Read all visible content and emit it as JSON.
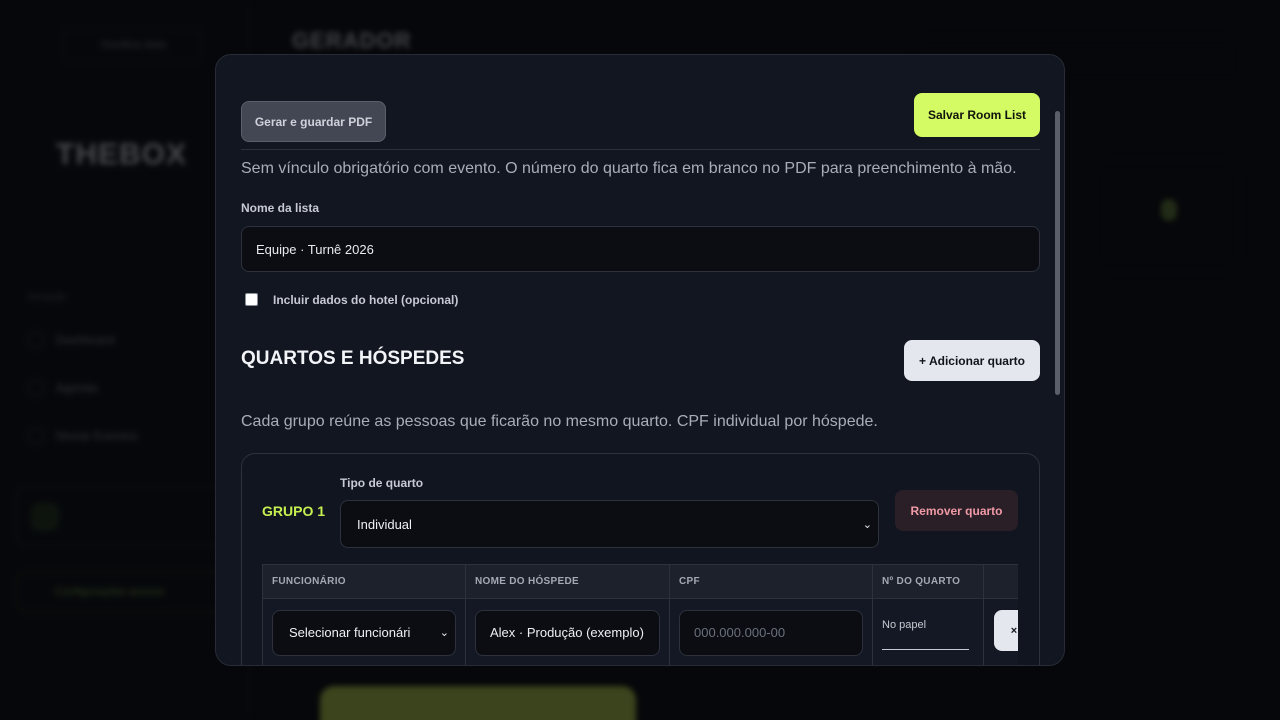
{
  "background": {
    "nav_pill_label": "Nivelbra data",
    "brand": "GERADOR",
    "logo": "THEBOX",
    "section_label": "Geração",
    "nav_items": [
      "Dashboard",
      "Agenda",
      "Nivear Eventos"
    ],
    "green_pill_label": "Configurações acesso"
  },
  "modal": {
    "pdf_button": "Gerar e guardar PDF",
    "save_button": "Salvar Room List",
    "intro": "Sem vínculo obrigatório com evento. O número do quarto fica em branco no PDF para preenchimento à mão.",
    "list_name_label": "Nome da lista",
    "list_name_value": "Equipe · Turnê 2026",
    "hotel_checkbox_label": "Incluir dados do hotel (opcional)",
    "hotel_checkbox_checked": false,
    "section_title": "QUARTOS E HÓSPEDES",
    "add_room_button": "+ Adicionar quarto",
    "section_desc": "Cada grupo reúne as pessoas que ficarão no mesmo quarto. CPF individual por hóspede.",
    "groups": [
      {
        "title": "GRUPO 1",
        "room_type_label": "Tipo de quarto",
        "room_type_value": "Individual",
        "remove_button": "Remover quarto",
        "columns": [
          "FUNCIONÁRIO",
          "NOME DO HÓSPEDE",
          "CPF",
          "Nº DO QUARTO"
        ],
        "rows": [
          {
            "employee": "Selecionar funcionári",
            "guest_name": "Alex · Produção (exemplo)",
            "cpf_placeholder": "000.000.000-00",
            "room_number": "No papel",
            "remove_label": "×"
          }
        ]
      }
    ]
  },
  "colors": {
    "accent": "#d4fb63",
    "group_title": "#c6f050",
    "danger_text": "#ef9aa6",
    "modal_bg": "#121620"
  }
}
